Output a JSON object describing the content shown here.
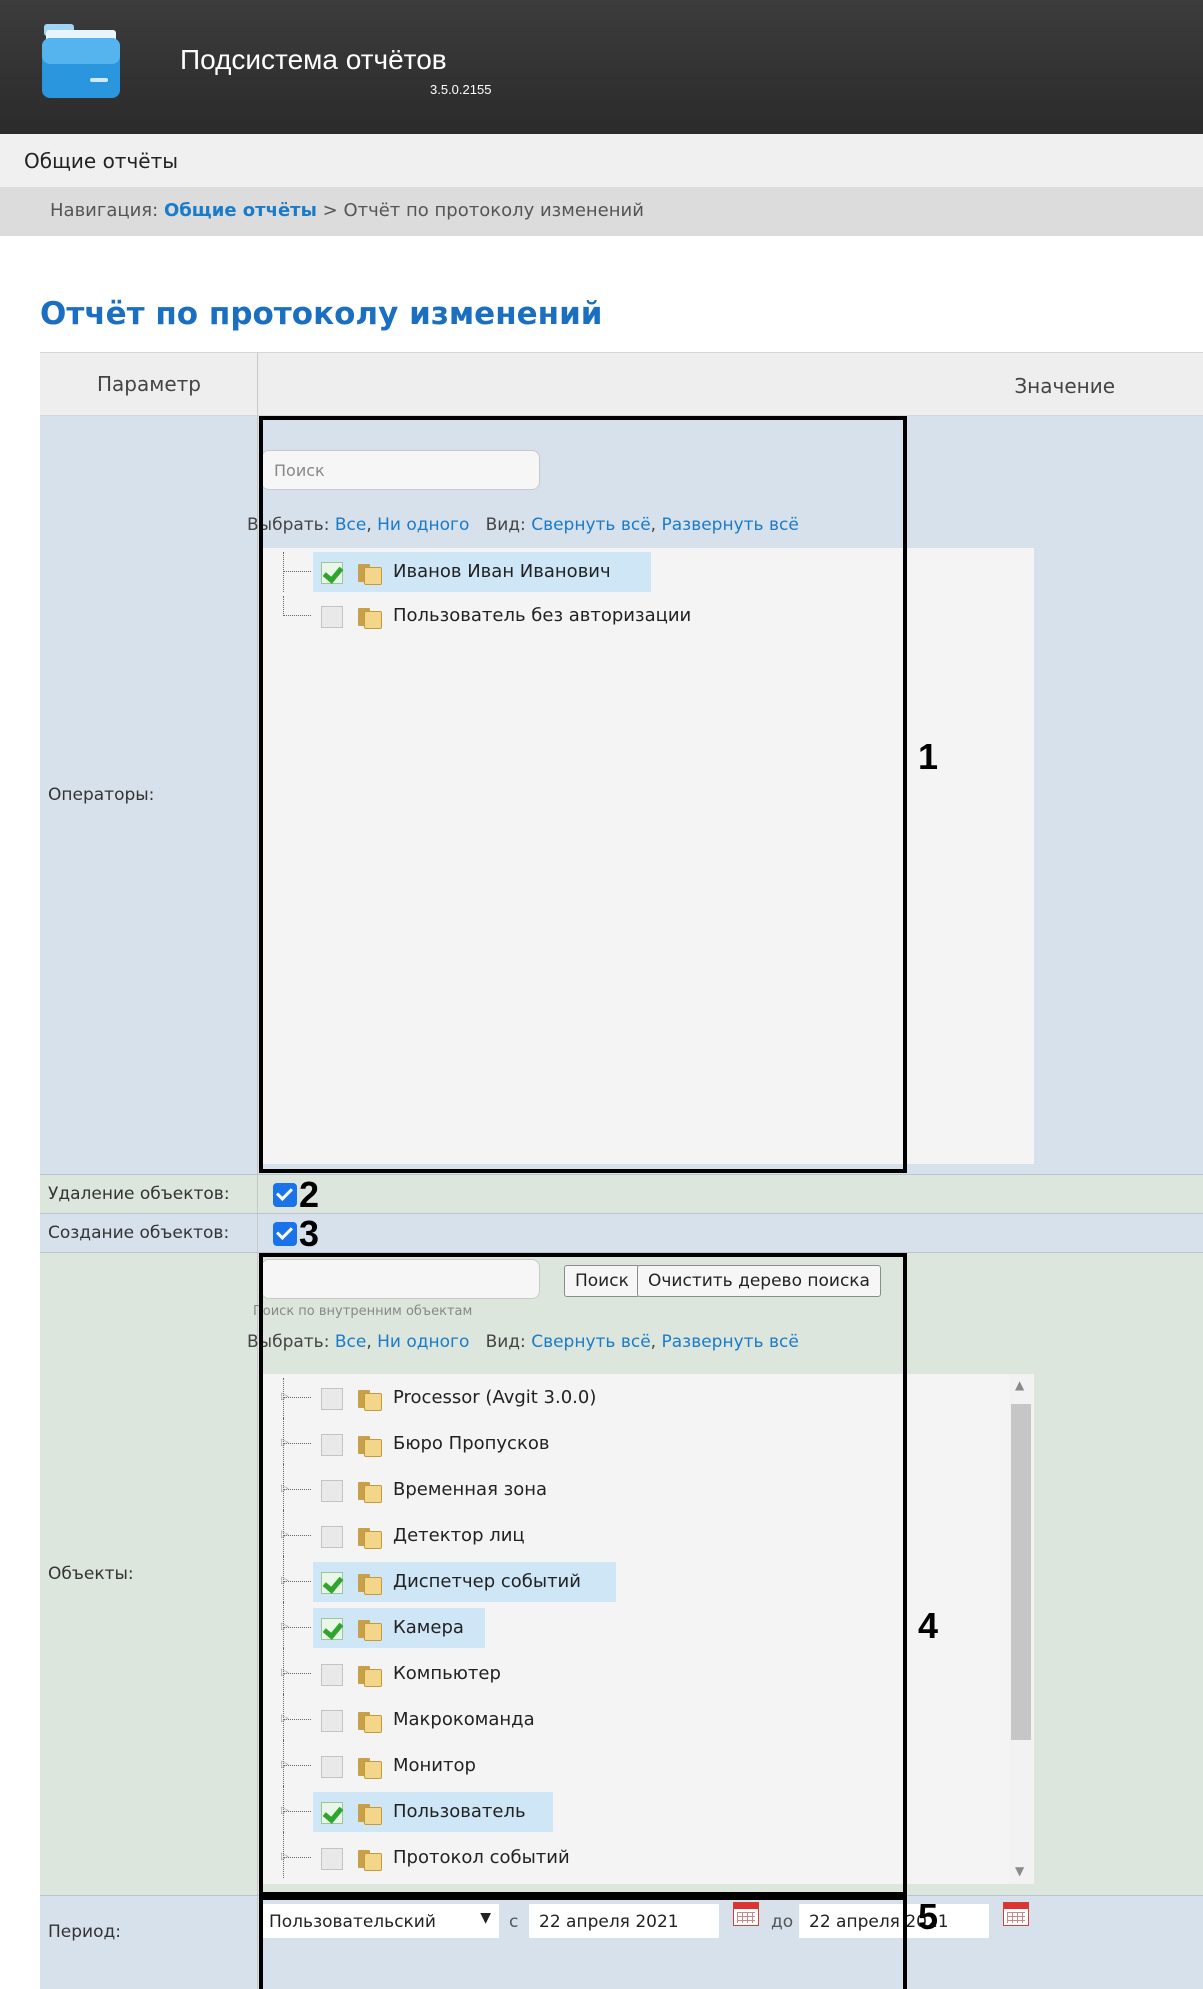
{
  "app": {
    "title": "Подсистема отчётов",
    "version": "3.5.0.2155"
  },
  "menu": {
    "item": "Общие отчёты"
  },
  "breadcrumb": {
    "prefix": "Навигация:",
    "link": "Общие отчёты",
    "separator": ">",
    "current": "Отчёт по протоколу изменений"
  },
  "page": {
    "title": "Отчёт по протоколу изменений"
  },
  "table": {
    "col_param": "Параметр",
    "col_value": "Значение"
  },
  "select_bar": {
    "select_label": "Выбрать:",
    "all": "Все",
    "none": "Ни одного",
    "view_label": "Вид:",
    "collapse": "Свернуть всё",
    "expand": "Развернуть всё"
  },
  "operators": {
    "label": "Операторы:",
    "search_placeholder": "Поиск",
    "items": [
      {
        "name": "Иванов Иван Иванович",
        "checked": true
      },
      {
        "name": "Пользователь без авторизации",
        "checked": false
      }
    ]
  },
  "deletion": {
    "label": "Удаление объектов:",
    "checked": true
  },
  "creation": {
    "label": "Создание объектов:",
    "checked": true
  },
  "objects": {
    "label": "Объекты:",
    "search_button": "Поиск",
    "clear_button": "Очистить дерево поиска",
    "search_hint": "Поиск по внутренним объектам",
    "items": [
      {
        "name": "Processor (Avgit 3.0.0)",
        "checked": false
      },
      {
        "name": "Бюро Пропусков",
        "checked": false
      },
      {
        "name": "Временная зона",
        "checked": false
      },
      {
        "name": "Детектор лиц",
        "checked": false
      },
      {
        "name": "Диспетчер событий",
        "checked": true
      },
      {
        "name": "Камера",
        "checked": true
      },
      {
        "name": "Компьютер",
        "checked": false
      },
      {
        "name": "Макрокоманда",
        "checked": false
      },
      {
        "name": "Монитор",
        "checked": false
      },
      {
        "name": "Пользователь",
        "checked": true
      },
      {
        "name": "Протокол событий",
        "checked": false
      }
    ]
  },
  "period": {
    "label": "Период:",
    "type": "Пользовательский",
    "from_word": "с",
    "from": "22 апреля 2021",
    "to_word": "до",
    "to": "22 апреля 2021"
  },
  "callouts": [
    "1",
    "2",
    "3",
    "4",
    "5"
  ]
}
